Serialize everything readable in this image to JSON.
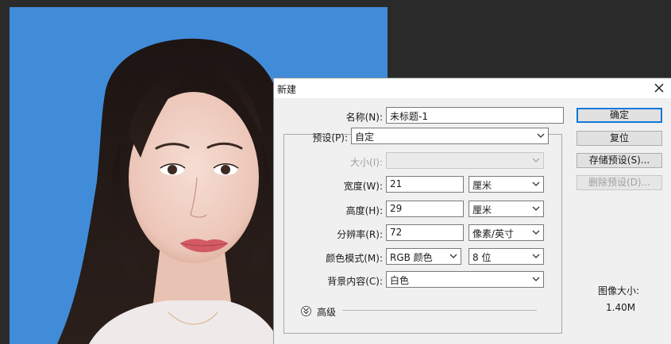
{
  "dialog": {
    "title": "新建",
    "name_label": "名称(N):",
    "name_value": "未标题-1",
    "preset_label": "预设(P):",
    "preset_value": "自定",
    "size_label": "大小(I):",
    "width_label": "宽度(W):",
    "width_value": "21",
    "width_unit": "厘米",
    "height_label": "高度(H):",
    "height_value": "29",
    "height_unit": "厘米",
    "resolution_label": "分辨率(R):",
    "resolution_value": "72",
    "resolution_unit": "像素/英寸",
    "color_mode_label": "颜色模式(M):",
    "color_mode_value": "RGB 颜色",
    "bit_depth_value": "8 位",
    "background_label": "背景内容(C):",
    "background_value": "白色",
    "advanced_label": "高级",
    "image_size_label": "图像大小:",
    "image_size_value": "1.40M"
  },
  "buttons": {
    "ok": "确定",
    "reset": "复位",
    "save_preset": "存储预设(S)...",
    "delete_preset": "删除预设(D)..."
  },
  "colors": {
    "canvas_background": "#418cd9",
    "app_background": "#2a2a2a",
    "dialog_background": "#f0f0f0",
    "focus_border": "#0f78d7"
  },
  "icons": [
    "close-icon",
    "chevron-down-icon",
    "expand-advanced-icon"
  ]
}
